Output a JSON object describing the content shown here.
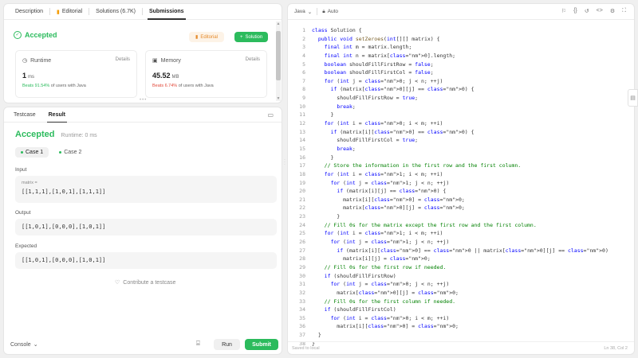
{
  "left_tabs": [
    "Description",
    "Editorial",
    "Solutions (6.7K)",
    "Submissions"
  ],
  "submission": {
    "status": "Accepted",
    "editorial_btn": "Editorial",
    "solution_btn": "Solution",
    "runtime": {
      "title": "Runtime",
      "details": "Details",
      "value": "1",
      "unit": "ms",
      "beats_pct": "Beats 91.54%",
      "beats_rest": "of users with Java"
    },
    "memory": {
      "title": "Memory",
      "details": "Details",
      "value": "45.52",
      "unit": "MB",
      "beats_pct": "Beats 6.74%",
      "beats_rest": "of users with Java"
    }
  },
  "bottom_tabs": [
    "Testcase",
    "Result"
  ],
  "result": {
    "status": "Accepted",
    "runtime": "Runtime: 0 ms",
    "cases": [
      "Case 1",
      "Case 2"
    ],
    "input_label": "Input",
    "matrix_label": "matrix =",
    "input_value": "[[1,1,1],[1,0,1],[1,1,1]]",
    "output_label": "Output",
    "output_value": "[[1,0,1],[0,0,0],[1,0,1]]",
    "expected_label": "Expected",
    "expected_value": "[[1,0,1],[0,0,0],[1,0,1]]",
    "contribute": "Contribute a testcase"
  },
  "footer": {
    "console": "Console",
    "run": "Run",
    "submit": "Submit"
  },
  "editor": {
    "language": "Java",
    "mode": "Auto",
    "saved": "Saved to local",
    "position": "Ln 38, Col 2",
    "lines": [
      "class Solution {",
      "  public void setZeroes(int[][] matrix) {",
      "    final int m = matrix.length;",
      "    final int n = matrix[0].length;",
      "    boolean shouldFillFirstRow = false;",
      "    boolean shouldFillFirstCol = false;",
      "    for (int j = 0; j < n; ++j)",
      "      if (matrix[0][j] == 0) {",
      "        shouldFillFirstRow = true;",
      "        break;",
      "      }",
      "    for (int i = 0; i < m; ++i)",
      "      if (matrix[i][0] == 0) {",
      "        shouldFillFirstCol = true;",
      "        break;",
      "      }",
      "    // Store the information in the first row and the first column.",
      "    for (int i = 1; i < m; ++i)",
      "      for (int j = 1; j < n; ++j)",
      "        if (matrix[i][j] == 0) {",
      "          matrix[i][0] = 0;",
      "          matrix[0][j] = 0;",
      "        }",
      "    // Fill 0s for the matrix except the first row and the first column.",
      "    for (int i = 1; i < m; ++i)",
      "      for (int j = 1; j < n; ++j)",
      "        if (matrix[i][0] == 0 || matrix[0][j] == 0)",
      "          matrix[i][j] = 0;",
      "    // Fill 0s for the first row if needed.",
      "    if (shouldFillFirstRow)",
      "      for (int j = 0; j < n; ++j)",
      "        matrix[0][j] = 0;",
      "    // Fill 0s for the first column if needed.",
      "    if (shouldFillFirstCol)",
      "      for (int i = 0; i < m; ++i)",
      "        matrix[i][0] = 0;",
      "  }",
      "}"
    ]
  },
  "colors": {
    "accent_green": "#2cbb5d",
    "editorial_orange": "#e58a2a",
    "beats_red": "#e24a3b"
  }
}
